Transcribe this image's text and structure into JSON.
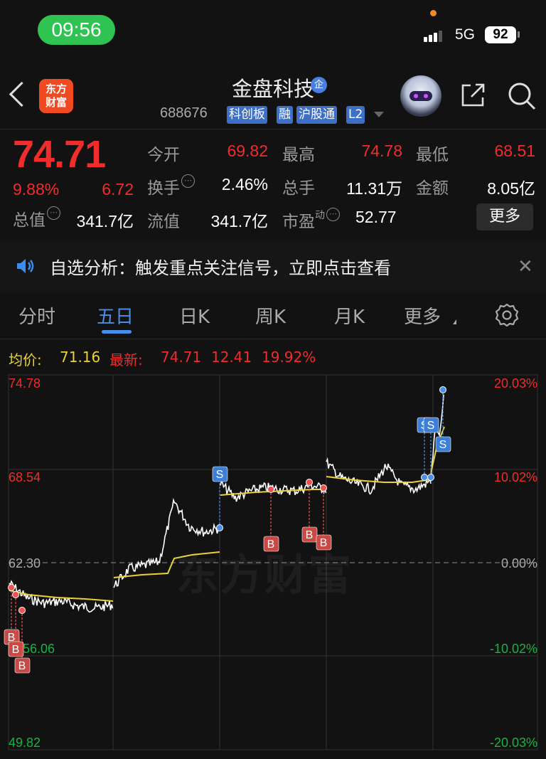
{
  "status": {
    "time": "09:56",
    "network": "5G",
    "battery": "92"
  },
  "header": {
    "logo": "东方\n财富",
    "title": "金盘科技",
    "badge": "企",
    "code": "688676",
    "tags": [
      "科创板",
      "融",
      "沪股通",
      "L2"
    ]
  },
  "quote": {
    "price": "74.71",
    "change_pct": "9.88%",
    "change": "6.72",
    "open_label": "今开",
    "open": "69.82",
    "high_label": "最高",
    "high": "74.78",
    "low_label": "最低",
    "low": "68.51",
    "turnover_label": "换手",
    "turnover": "2.46%",
    "volume_label": "总手",
    "volume": "11.31万",
    "amount_label": "金额",
    "amount": "8.05亿",
    "mcap_label": "总值",
    "mcap": "341.7亿",
    "float_label": "流值",
    "float": "341.7亿",
    "pe_label": "市盈",
    "pe_sup": "动",
    "pe": "52.77",
    "more": "更多"
  },
  "notice": {
    "text": "自选分析：触发重点关注信号，立即点击查看"
  },
  "tabs": [
    "分时",
    "五日",
    "日K",
    "周K",
    "月K",
    "更多"
  ],
  "chart": {
    "avg_label": "均价:",
    "avg": "71.16",
    "latest_label": "最新:",
    "latest": "74.71",
    "latest_change": "12.41",
    "latest_pct": "19.92%",
    "y_left": [
      "74.78",
      "68.54",
      "62.30",
      "56.06",
      "49.82"
    ],
    "y_right": [
      "20.03%",
      "10.02%",
      "0.00%",
      "-10.02%",
      "-20.03%"
    ],
    "watermark": "东方财富",
    "markers": {
      "buy": "B",
      "sell": "S"
    }
  },
  "colors": {
    "up": "#f02c2c",
    "down": "#19b245",
    "accent": "#4a8de8",
    "avg_line": "#e8d23a"
  }
}
